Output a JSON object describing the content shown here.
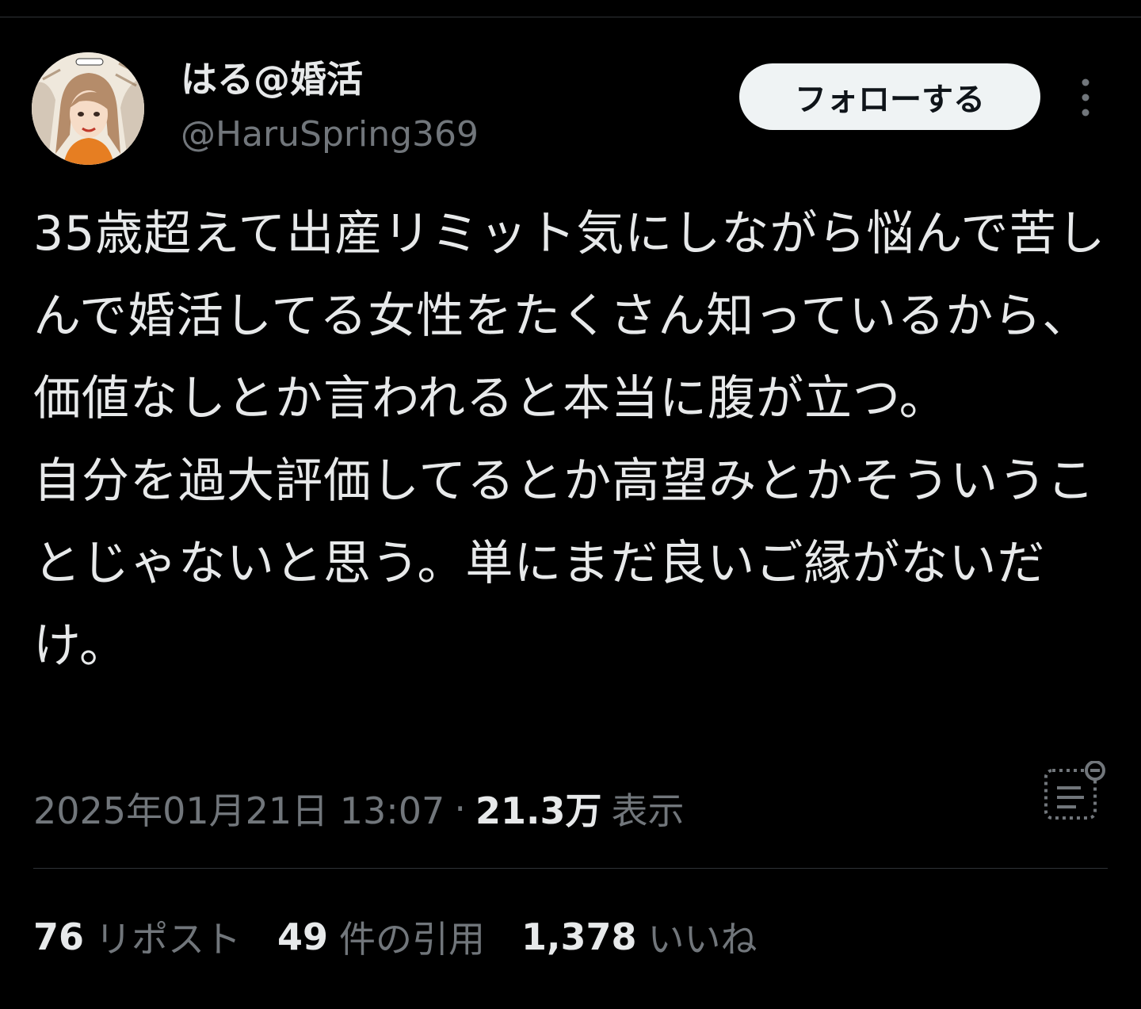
{
  "author": {
    "display_name": "はる@婚活",
    "handle": "@HaruSpring369"
  },
  "follow_button": {
    "label": "フォローする"
  },
  "tweet": {
    "text": "35歳超えて出産リミット気にしながら悩んで苦しんで婚活してる女性をたくさん知っているから、価値なしとか言われると本当に腹が立つ。\n自分を過大評価してるとか高望みとかそういうことじゃないと思う。単にまだ良いご縁がないだけ。"
  },
  "meta": {
    "timestamp": "2025年01月21日 13:07",
    "separator": "·",
    "views_count": "21.3万",
    "views_label": "表示"
  },
  "stats": {
    "reposts": {
      "count": "76",
      "label": "リポスト"
    },
    "quotes": {
      "count": "49",
      "label": "件の引用"
    },
    "likes": {
      "count": "1,378",
      "label": "いいね"
    }
  },
  "icons": {
    "more": "more-vertical-icon",
    "analytics": "analytics-icon"
  },
  "colors": {
    "background": "#000000",
    "primary_text": "#e7e9ea",
    "secondary_text": "#71767b",
    "divider": "#2f3336",
    "button_bg": "#eff3f4"
  }
}
